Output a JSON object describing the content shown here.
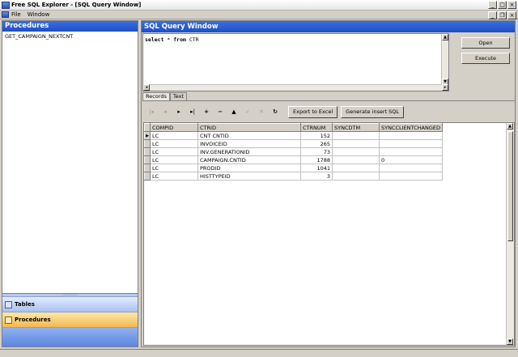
{
  "window": {
    "title": "Free SQL Explorer - [SQL Query Window]",
    "minimize_glyph": "_",
    "maximize_glyph": "□",
    "close_glyph": "×"
  },
  "menu": {
    "items": [
      "File",
      "Window"
    ],
    "mdi_minimize_glyph": "_",
    "mdi_restore_glyph": "❐",
    "mdi_close_glyph": "×"
  },
  "left": {
    "header": "Procedures",
    "procedures": [
      "GET_CAMPAIGN_NEXTCNT"
    ],
    "splitter_glyph": "::::::::::",
    "nav": {
      "tables": "Tables",
      "procedures": "Procedures"
    }
  },
  "query": {
    "header": "SQL Query Window",
    "select_kw": "select",
    "star": "*",
    "from_kw": "from",
    "table": "CTR",
    "open_button": "Open",
    "execute_button": "Execute"
  },
  "tabs": [
    "Records",
    "Text"
  ],
  "toolbar": {
    "first_glyph": "|◂",
    "prev_glyph": "◂",
    "next_glyph": "▸",
    "last_glyph": "▸|",
    "insert_glyph": "+",
    "delete_glyph": "−",
    "edit_glyph": "▲",
    "post_glyph": "✓",
    "cancel_glyph": "✕",
    "refresh_glyph": "↻",
    "export_label": "Export to Excel",
    "generate_label": "Generate insert SQL"
  },
  "grid": {
    "columns": [
      "COMPID",
      "CTRID",
      "CTRNUM",
      "SYNCDTM",
      "SYNCCLIENTCHANGED"
    ],
    "current_row_glyph": "▶",
    "rows": [
      [
        "LC",
        "CNT CNTID",
        "152",
        "",
        ""
      ],
      [
        "LC",
        "INVOICEID",
        "265",
        "",
        ""
      ],
      [
        "LC",
        "INV.GENERATIONID",
        "73",
        "",
        ""
      ],
      [
        "LC",
        "CAMPAIGN.CNTID",
        "1788",
        "",
        "0"
      ],
      [
        "LC",
        "PRODID",
        "1041",
        "",
        ""
      ],
      [
        "LC",
        "HISTTYPEID",
        "3",
        "",
        ""
      ]
    ]
  },
  "scroll": {
    "up": "▲",
    "down": "▼",
    "left": "◂",
    "right": "▸"
  }
}
